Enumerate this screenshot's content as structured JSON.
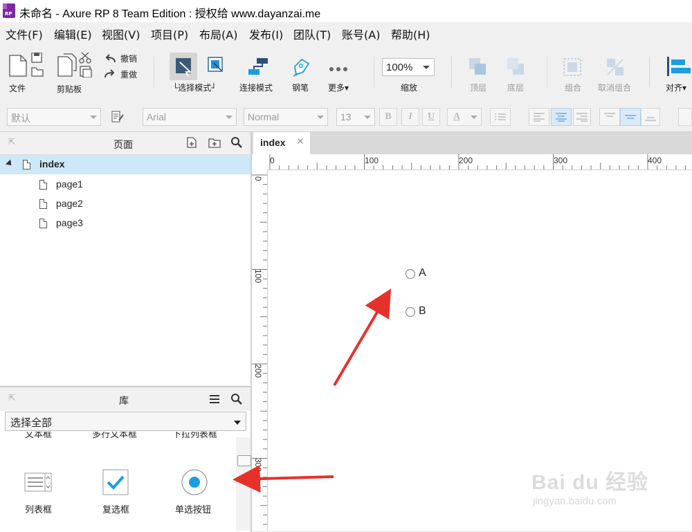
{
  "window": {
    "title": "未命名 - Axure RP 8 Team Edition : 授权给 www.dayanzai.me",
    "logo_text": "RP"
  },
  "menu": [
    "文件(F)",
    "编辑(E)",
    "视图(V)",
    "项目(P)",
    "布局(A)",
    "发布(I)",
    "团队(T)",
    "账号(A)",
    "帮助(H)"
  ],
  "toolbar": {
    "file": "文件",
    "clipboard": "剪贴板",
    "undo": "撤销",
    "redo": "重做",
    "select_mode": "选择模式",
    "connect_mode": "连接模式",
    "pen": "钢笔",
    "more": "更多",
    "zoom_value": "100%",
    "zoom_label": "缩放",
    "top_layer": "顶层",
    "bottom_layer": "底层",
    "group": "组合",
    "ungroup": "取消组合",
    "align": "对齐"
  },
  "format_bar": {
    "style": "默认",
    "font": "Arial",
    "weight": "Normal",
    "size": "13",
    "bold": "B",
    "italic": "I",
    "underline": "U",
    "font_color": "A"
  },
  "pages_panel": {
    "title": "页面",
    "root": "index",
    "children": [
      "page1",
      "page2",
      "page3"
    ]
  },
  "library_panel": {
    "title": "库",
    "selected_library": "选择全部",
    "partial_row": [
      "文本框",
      "多行文本框",
      "下拉列表框"
    ],
    "widgets": [
      "列表框",
      "复选框",
      "单选按钮"
    ]
  },
  "canvas": {
    "tab": "index",
    "ruler_h": [
      "0",
      "100",
      "200",
      "300",
      "400"
    ],
    "ruler_v": [
      "0",
      "100",
      "200",
      "300"
    ],
    "radio_options": [
      "A",
      "B"
    ]
  },
  "colors": {
    "accent": "#1a9ee0",
    "selection": "#cde8f7",
    "arrow": "#e8302a",
    "logo": "#7b2aa0"
  },
  "watermark": {
    "brand": "Bai du 经验",
    "url": "jingyan.baidu.com"
  }
}
